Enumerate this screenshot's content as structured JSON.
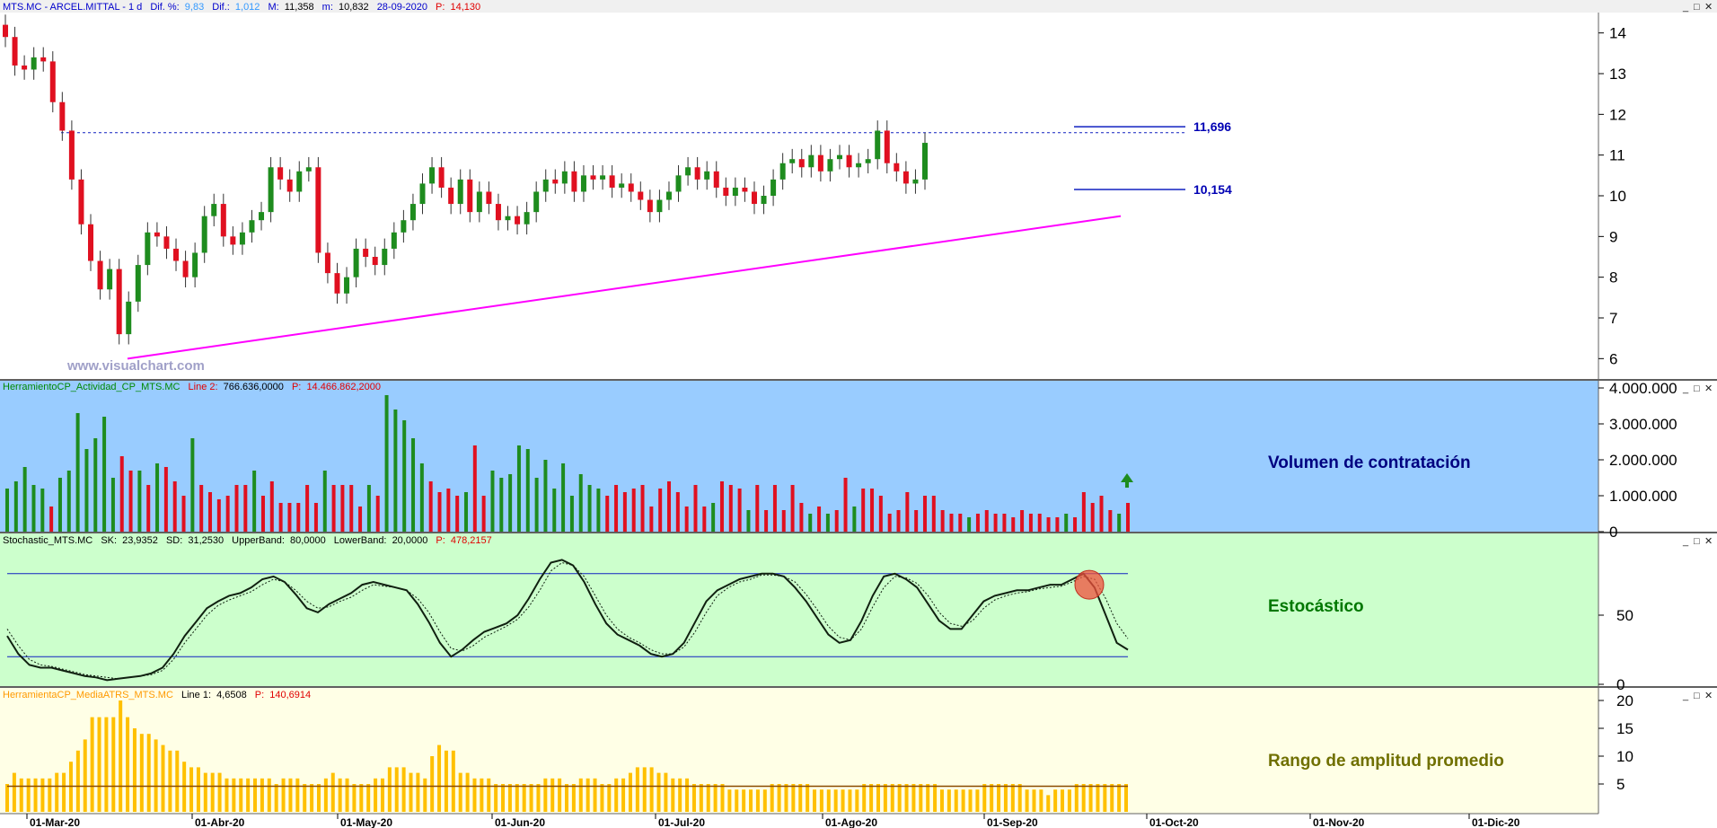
{
  "colors": {
    "up": "#1e8c1e",
    "down": "#e01020",
    "neutral": "#1020d0",
    "trend": "#ff00ff",
    "level": "#1020c0",
    "vol_bg": "#99ccff",
    "stoch_bg": "#ccffcc",
    "atr_bg": "#ffffe6",
    "atr_bar": "#ffc000",
    "header_blue": "#0000cc",
    "header_red": "#e00000",
    "header_green": "#008800",
    "header_orange": "#ff9900"
  },
  "header": {
    "symbol": "MTS.MC - ARCEL.MITTAL -  1 d",
    "dif_pct_label": "Dif. %:",
    "dif_pct": "9,83",
    "dif_label": "Dif.:",
    "dif": "1,012",
    "max_label": "M:",
    "max": "11,358",
    "min_label": "m:",
    "min": "10,832",
    "date": "28-09-2020",
    "p_label": "P:",
    "p": "14,130"
  },
  "watermark": "www.visualchart.com",
  "window_buttons": [
    "_",
    "□",
    "✕"
  ],
  "chart_data": [
    {
      "type": "candlestick",
      "y_ticks": [
        "14",
        "13",
        "12",
        "11",
        "10",
        "9",
        "8",
        "7",
        "6"
      ],
      "ylim": [
        5.5,
        14.5
      ],
      "annotations": [
        {
          "label": "11,696",
          "value": 11.696
        },
        {
          "label": "10,154",
          "value": 10.154
        }
      ],
      "resistance_level": 11.55,
      "trendline": {
        "from": 6.0,
        "to": 9.5
      },
      "candles_close": [
        13.9,
        13.2,
        13.1,
        13.4,
        13.3,
        12.3,
        11.6,
        10.4,
        9.3,
        8.4,
        7.7,
        8.2,
        6.6,
        7.4,
        8.3,
        9.1,
        9.0,
        8.7,
        8.4,
        8.0,
        8.6,
        9.5,
        9.8,
        9.0,
        8.8,
        9.1,
        9.4,
        9.6,
        10.7,
        10.4,
        10.1,
        10.6,
        10.7,
        8.6,
        8.1,
        7.6,
        8.0,
        8.7,
        8.5,
        8.3,
        8.7,
        9.1,
        9.4,
        9.8,
        10.3,
        10.7,
        10.2,
        9.8,
        10.4,
        9.6,
        10.1,
        9.8,
        9.4,
        9.5,
        9.3,
        9.6,
        10.1,
        10.4,
        10.3,
        10.6,
        10.1,
        10.5,
        10.4,
        10.5,
        10.2,
        10.3,
        10.1,
        9.9,
        9.6,
        9.9,
        10.1,
        10.5,
        10.7,
        10.4,
        10.6,
        10.2,
        10.0,
        10.2,
        10.1,
        9.8,
        10.0,
        10.4,
        10.8,
        10.9,
        10.7,
        11.0,
        10.6,
        10.9,
        11.0,
        10.7,
        10.8,
        10.9,
        11.6,
        10.8,
        10.6,
        10.3,
        10.4,
        11.3
      ],
      "x_ticks": [
        "01-Mar-20",
        "01-Abr-20",
        "01-May-20",
        "01-Jun-20",
        "01-Jul-20",
        "01-Ago-20",
        "01-Sep-20",
        "01-Oct-20",
        "01-Nov-20",
        "01-Dic-20"
      ]
    },
    {
      "type": "bar",
      "header": {
        "name": "HerramientoCP_Actividad_CP_MTS.MC",
        "line2_label": "Line 2:",
        "line2": "766.636,0000",
        "p_label": "P:",
        "p": "14.466.862,2000"
      },
      "title": "Volumen de contratación",
      "y_ticks": [
        "4.000.000",
        "3.000.000",
        "2.000.000",
        "1.000.000",
        "0"
      ],
      "ylim": [
        0,
        4000000
      ],
      "values": [
        1200000,
        1400000,
        1800000,
        1300000,
        1200000,
        700000,
        1500000,
        1700000,
        3300000,
        2300000,
        2600000,
        3200000,
        1500000,
        2100000,
        1700000,
        1700000,
        1300000,
        1900000,
        1800000,
        1400000,
        1000000,
        2600000,
        1300000,
        1100000,
        900000,
        1000000,
        1300000,
        1300000,
        1700000,
        1000000,
        1400000,
        800000,
        800000,
        800000,
        1300000,
        800000,
        1700000,
        1300000,
        1300000,
        1300000,
        700000,
        1300000,
        1000000,
        3800000,
        3400000,
        3100000,
        2600000,
        1900000,
        1400000,
        1100000,
        1200000,
        1000000,
        1100000,
        2400000,
        1000000,
        1700000,
        1500000,
        1600000,
        2400000,
        2300000,
        1500000,
        2000000,
        1200000,
        1900000,
        1000000,
        1600000,
        1300000,
        1200000,
        1000000,
        1300000,
        1100000,
        1200000,
        1300000,
        700000,
        1200000,
        1400000,
        1100000,
        700000,
        1300000,
        700000,
        800000,
        1400000,
        1300000,
        1200000,
        600000,
        1300000,
        600000,
        1300000,
        600000,
        1300000,
        800000,
        500000,
        700000,
        500000,
        600000,
        1500000,
        700000,
        1200000,
        1200000,
        1000000,
        500000,
        600000,
        1100000,
        600000,
        1000000,
        1000000,
        600000,
        500000,
        500000,
        400000,
        500000,
        600000,
        500000,
        500000,
        400000,
        600000,
        500000,
        500000,
        400000,
        400000,
        500000,
        400000,
        1100000,
        800000,
        1000000,
        600000,
        500000,
        800000
      ],
      "colors": [
        "u",
        "u",
        "u",
        "u",
        "u",
        "d",
        "u",
        "u",
        "u",
        "u",
        "u",
        "u",
        "u",
        "d",
        "d",
        "u",
        "d",
        "u",
        "d",
        "d",
        "d",
        "u",
        "d",
        "d",
        "d",
        "d",
        "d",
        "d",
        "u",
        "d",
        "d",
        "d",
        "d",
        "d",
        "d",
        "d",
        "u",
        "d",
        "d",
        "d",
        "d",
        "u",
        "d",
        "u",
        "u",
        "u",
        "u",
        "u",
        "d",
        "d",
        "d",
        "d",
        "u",
        "d",
        "d",
        "u",
        "u",
        "u",
        "u",
        "u",
        "u",
        "u",
        "u",
        "u",
        "u",
        "u",
        "u",
        "u",
        "d",
        "d",
        "d",
        "d",
        "d",
        "d",
        "d",
        "d",
        "d",
        "d",
        "d",
        "d",
        "u",
        "d",
        "d",
        "d",
        "u",
        "d",
        "d",
        "d",
        "d",
        "d",
        "d",
        "u",
        "d",
        "u",
        "d",
        "d",
        "u",
        "d",
        "d",
        "d",
        "d",
        "d",
        "d",
        "d",
        "d",
        "d",
        "d",
        "d",
        "d",
        "u",
        "d",
        "d",
        "d",
        "d",
        "d",
        "d",
        "d",
        "d",
        "d",
        "d",
        "u",
        "d",
        "d",
        "d",
        "d",
        "d",
        "u",
        "d",
        "d"
      ],
      "arrow": "up"
    },
    {
      "type": "line",
      "header": {
        "name": "Stochastic_MTS.MC",
        "sk_label": "SK:",
        "sk": "23,9352",
        "sd_label": "SD:",
        "sd": "31,2530",
        "upper_label": "UpperBand:",
        "upper": "80,0000",
        "lower_label": "LowerBand:",
        "lower": "20,0000",
        "p_label": "P:",
        "p": "478,2157"
      },
      "title": "Estocástico",
      "y_ticks": [
        "50",
        "0"
      ],
      "ylim": [
        0,
        100
      ],
      "bands": [
        80,
        20
      ],
      "series": [
        {
          "values": [
            35,
            22,
            14,
            12,
            12,
            10,
            8,
            6,
            5,
            3,
            4,
            5,
            6,
            8,
            12,
            22,
            35,
            45,
            55,
            60,
            64,
            66,
            70,
            76,
            78,
            74,
            65,
            55,
            52,
            58,
            62,
            66,
            72,
            74,
            72,
            70,
            68,
            58,
            45,
            30,
            20,
            25,
            32,
            38,
            41,
            44,
            50,
            62,
            76,
            88,
            90,
            86,
            74,
            58,
            44,
            36,
            32,
            28,
            22,
            20,
            22,
            30,
            45,
            60,
            68,
            72,
            76,
            78,
            80,
            80,
            78,
            70,
            60,
            48,
            36,
            30,
            32,
            46,
            64,
            78,
            80,
            76,
            70,
            58,
            46,
            40,
            40,
            50,
            60,
            64,
            66,
            68,
            68,
            70,
            72,
            72,
            76,
            80,
            70,
            50,
            30,
            25
          ]
        },
        {
          "values": [
            40,
            28,
            18,
            14,
            13,
            11,
            9,
            7,
            6,
            5,
            4,
            5,
            6,
            7,
            10,
            18,
            30,
            40,
            50,
            57,
            61,
            64,
            67,
            72,
            76,
            74,
            68,
            60,
            55,
            56,
            60,
            63,
            68,
            72,
            71,
            70,
            68,
            62,
            52,
            38,
            26,
            24,
            28,
            34,
            38,
            42,
            47,
            56,
            68,
            82,
            88,
            86,
            78,
            64,
            50,
            40,
            34,
            30,
            25,
            22,
            22,
            27,
            38,
            52,
            64,
            70,
            74,
            76,
            79,
            79,
            78,
            74,
            65,
            54,
            42,
            34,
            32,
            40,
            56,
            70,
            78,
            77,
            73,
            64,
            52,
            44,
            42,
            46,
            55,
            61,
            64,
            66,
            67,
            69,
            70,
            71,
            74,
            78,
            76,
            62,
            44,
            33
          ]
        }
      ],
      "marker": {
        "value": 72
      }
    },
    {
      "type": "bar",
      "header": {
        "name": "HerramientaCP_MediaATRS_MTS.MC",
        "line1_label": "Line 1:",
        "line1": "4,6508",
        "p_label": "P:",
        "p": "140,6914"
      },
      "title": "Rango de amplitud promedio",
      "y_ticks": [
        "20",
        "15",
        "10",
        "5"
      ],
      "ylim": [
        0,
        20
      ],
      "values": [
        5,
        7,
        6,
        6,
        6,
        6,
        6,
        7,
        7,
        9,
        11,
        13,
        17,
        17,
        17,
        17,
        20,
        17,
        15,
        14,
        14,
        13,
        12,
        11,
        11,
        9,
        8,
        8,
        7,
        7,
        7,
        6,
        6,
        6,
        6,
        6,
        6,
        6,
        5,
        6,
        6,
        6,
        5,
        5,
        5,
        6,
        7,
        6,
        6,
        5,
        5,
        5,
        6,
        6,
        8,
        8,
        8,
        7,
        7,
        6,
        10,
        12,
        11,
        11,
        7,
        7,
        6,
        6,
        6,
        5,
        5,
        5,
        5,
        5,
        5,
        5,
        6,
        6,
        6,
        5,
        5,
        6,
        6,
        6,
        5,
        5,
        6,
        6,
        7,
        8,
        8,
        8,
        7,
        7,
        6,
        6,
        6,
        5,
        5,
        5,
        5,
        5,
        4,
        4,
        4,
        4,
        4,
        4,
        5,
        5,
        5,
        5,
        5,
        5,
        4,
        4,
        4,
        4,
        4,
        4,
        4,
        5,
        5,
        5,
        5,
        5,
        5,
        5,
        5,
        5,
        5,
        5,
        4,
        4,
        4,
        4,
        4,
        4,
        5,
        5,
        5,
        5,
        5,
        5,
        4,
        4,
        4,
        3,
        4,
        4,
        4,
        5,
        5,
        5,
        5,
        5,
        5,
        5,
        5
      ],
      "mean_line": 4.6
    }
  ]
}
